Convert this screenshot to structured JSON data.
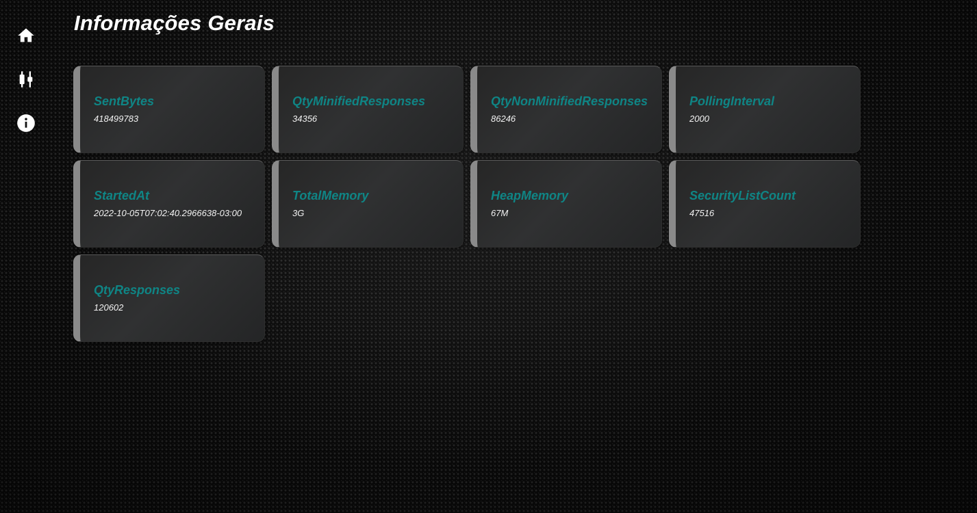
{
  "page": {
    "title": "Informações Gerais"
  },
  "sidebar": {
    "items": [
      {
        "icon": "home-icon"
      },
      {
        "icon": "candlestick-chart-icon"
      },
      {
        "icon": "info-icon"
      }
    ]
  },
  "theme": {
    "accent": "#0f8585",
    "card_border": "#8a8a8a",
    "text": "#ffffff"
  },
  "cards": [
    {
      "label": "SentBytes",
      "value": "418499783"
    },
    {
      "label": "QtyMinifiedResponses",
      "value": "34356"
    },
    {
      "label": "QtyNonMinifiedResponses",
      "value": "86246"
    },
    {
      "label": "PollingInterval",
      "value": "2000"
    },
    {
      "label": "StartedAt",
      "value": "2022-10-05T07:02:40.2966638-03:00"
    },
    {
      "label": "TotalMemory",
      "value": "3G"
    },
    {
      "label": "HeapMemory",
      "value": "67M"
    },
    {
      "label": "SecurityListCount",
      "value": "47516"
    },
    {
      "label": "QtyResponses",
      "value": "120602"
    }
  ]
}
